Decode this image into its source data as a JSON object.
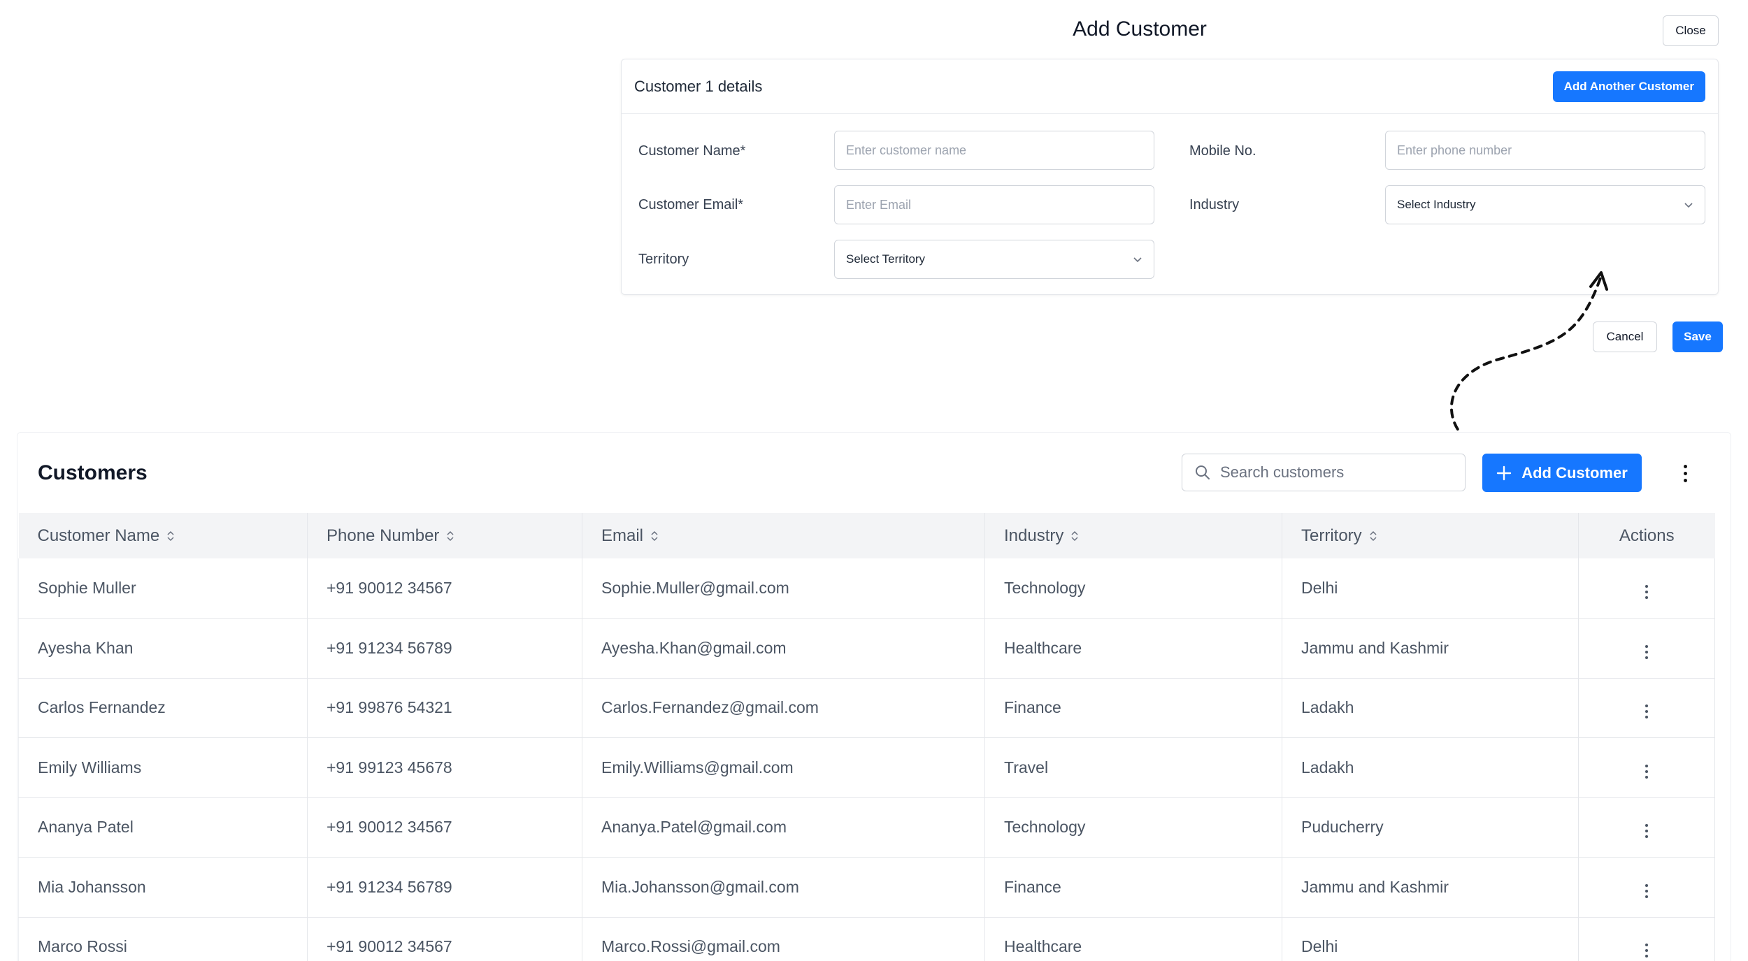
{
  "modal": {
    "title": "Add Customer",
    "close_label": "Close",
    "card_title": "Customer 1 details",
    "add_another_label": "Add Another Customer",
    "fields": {
      "customer_name": {
        "label": "Customer Name*",
        "placeholder": "Enter customer name"
      },
      "mobile_no": {
        "label": "Mobile No.",
        "placeholder": "Enter phone number"
      },
      "customer_email": {
        "label": "Customer Email*",
        "placeholder": "Enter Email"
      },
      "industry": {
        "label": "Industry",
        "value": "Select Industry"
      },
      "territory": {
        "label": "Territory",
        "value": "Select Territory"
      }
    },
    "cancel_label": "Cancel",
    "save_label": "Save"
  },
  "customers": {
    "title": "Customers",
    "search_placeholder": "Search customers",
    "add_button_label": "Add Customer",
    "columns": [
      "Customer Name",
      "Phone Number",
      "Email",
      "Industry",
      "Territory",
      "Actions"
    ],
    "rows": [
      [
        "Sophie Muller",
        "+91 90012 34567",
        "Sophie.Muller@gmail.com",
        "Technology",
        "Delhi"
      ],
      [
        "Ayesha Khan",
        "+91 91234 56789",
        "Ayesha.Khan@gmail.com",
        "Healthcare",
        "Jammu and Kashmir"
      ],
      [
        "Carlos Fernandez",
        "+91 99876 54321",
        "Carlos.Fernandez@gmail.com",
        "Finance",
        "Ladakh"
      ],
      [
        "Emily Williams",
        "+91 99123 45678",
        "Emily.Williams@gmail.com",
        "Travel",
        "Ladakh"
      ],
      [
        "Ananya Patel",
        "+91 90012 34567",
        "Ananya.Patel@gmail.com",
        "Technology",
        "Puducherry"
      ],
      [
        "Mia Johansson",
        "+91 91234 56789",
        "Mia.Johansson@gmail.com",
        "Finance",
        "Jammu and Kashmir"
      ],
      [
        "Marco Rossi",
        "+91 90012 34567",
        "Marco.Rossi@gmail.com",
        "Healthcare",
        "Delhi"
      ]
    ]
  },
  "colors": {
    "primary": "#1677ff",
    "header_bg": "#f3f4f6",
    "border": "#e5e7eb"
  }
}
